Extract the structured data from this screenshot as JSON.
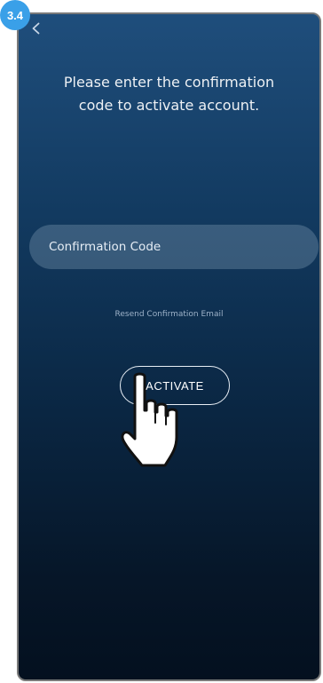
{
  "step_badge": "3.4",
  "screen": {
    "instruction_line1": "Please enter the confirmation",
    "instruction_line2": "code to activate account.",
    "code_input": {
      "placeholder": "Confirmation Code"
    },
    "resend_link": "Resend Confirmation Email",
    "activate_label": "ACTIVATE"
  },
  "icons": {
    "back": "chevron-left-icon",
    "pointer": "hand-pointer-icon"
  },
  "colors": {
    "badge": "#3aa0e8",
    "gradient_top": "#1f4e7c",
    "gradient_bottom": "#04101f"
  }
}
